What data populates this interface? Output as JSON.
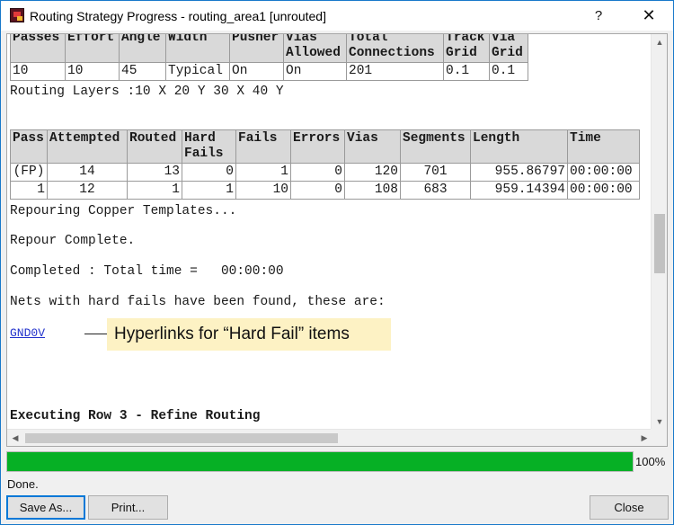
{
  "window": {
    "title": "Routing Strategy Progress - routing_area1 [unrouted]",
    "help_glyph": "?",
    "close_glyph": "✕"
  },
  "strategy_table": {
    "headers": [
      "Passes",
      "Effort",
      "Angle",
      "Width",
      "Pusher",
      "Vias Allowed",
      "Total Connections",
      "Track Grid",
      "Via Grid"
    ],
    "row": [
      "10",
      "10",
      "45",
      "Typical",
      "On",
      "On",
      "201",
      "0.1",
      "0.1"
    ]
  },
  "routing_layers": "Routing Layers :10 X 20 Y 30 X 40 Y",
  "pass_table": {
    "headers": [
      "Pass",
      "Attempted",
      "Routed",
      "Hard Fails",
      "Fails",
      "Errors",
      "Vias",
      "Segments",
      "Length",
      "Time"
    ],
    "rows": [
      [
        "(FP)",
        "14",
        "13",
        "0",
        "1",
        "0",
        "120",
        "701",
        "955.86797",
        "00:00:00"
      ],
      [
        "1",
        "12",
        "1",
        "1",
        "10",
        "0",
        "108",
        "683",
        "959.14394",
        "00:00:00"
      ]
    ]
  },
  "log": {
    "repouring": "Repouring Copper Templates...",
    "repour_complete": "Repour Complete.",
    "completed": "Completed : Total time =   00:00:00",
    "nets_hard_fails": "Nets with hard fails have been found, these are:",
    "hard_fail_net": "GND0V",
    "executing": "Executing Row 3 - Refine Routing"
  },
  "callout": {
    "text": "Hyperlinks for “Hard Fail” items"
  },
  "progress": {
    "value": 1.0,
    "label": "100%",
    "color": "#06b025"
  },
  "status": "Done.",
  "buttons": {
    "save_as": "Save As...",
    "print": "Print...",
    "close": "Close"
  }
}
